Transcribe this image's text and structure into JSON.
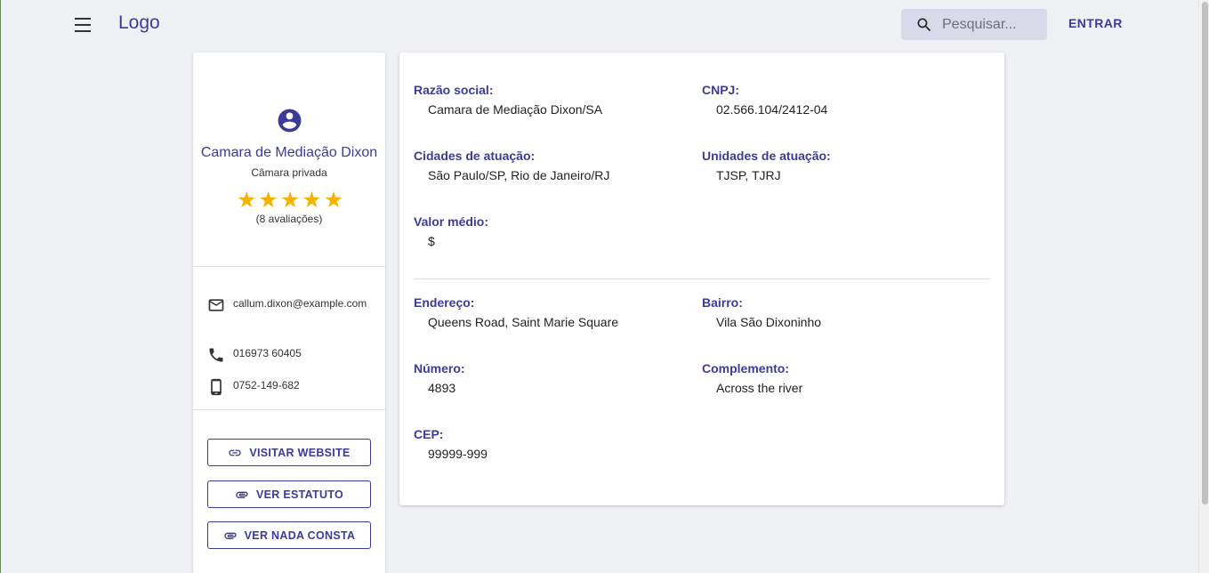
{
  "header": {
    "logo": "Logo",
    "search_placeholder": "Pesquisar...",
    "login_label": "ENTRAR"
  },
  "profile": {
    "name": "Camara de Mediação Dixon",
    "type": "Câmara privada",
    "rating": 5,
    "rating_max": 5,
    "reviews": "(8 avaliações)",
    "email": "callum.dixon@example.com",
    "phone": "016973 60405",
    "mobile": "0752-149-682",
    "buttons": {
      "website": "VISITAR WEBSITE",
      "statute": "VER ESTATUTO",
      "clearance": "VER NADA CONSTA"
    }
  },
  "details": {
    "razao_social": {
      "label": "Razão social:",
      "value": "Camara de Mediação Dixon/SA"
    },
    "cnpj": {
      "label": "CNPJ:",
      "value": "02.566.104/2412-04"
    },
    "cidades": {
      "label": "Cidades de atuação:",
      "value": "São Paulo/SP, Rio de Janeiro/RJ"
    },
    "unidades": {
      "label": "Unidades de atuação:",
      "value": "TJSP, TJRJ"
    },
    "valor_medio": {
      "label": "Valor médio:",
      "value": "$"
    },
    "endereco": {
      "label": "Endereço:",
      "value": "Queens Road, Saint Marie Square"
    },
    "bairro": {
      "label": "Bairro:",
      "value": "Vila São Dixoninho"
    },
    "numero": {
      "label": "Número:",
      "value": "4893"
    },
    "complemento": {
      "label": "Complemento:",
      "value": "Across the river"
    },
    "cep": {
      "label": "CEP:",
      "value": "99999-999"
    }
  },
  "colors": {
    "primary": "#3b3b9a",
    "star": "#f5b400",
    "background": "#f0f1f5"
  }
}
